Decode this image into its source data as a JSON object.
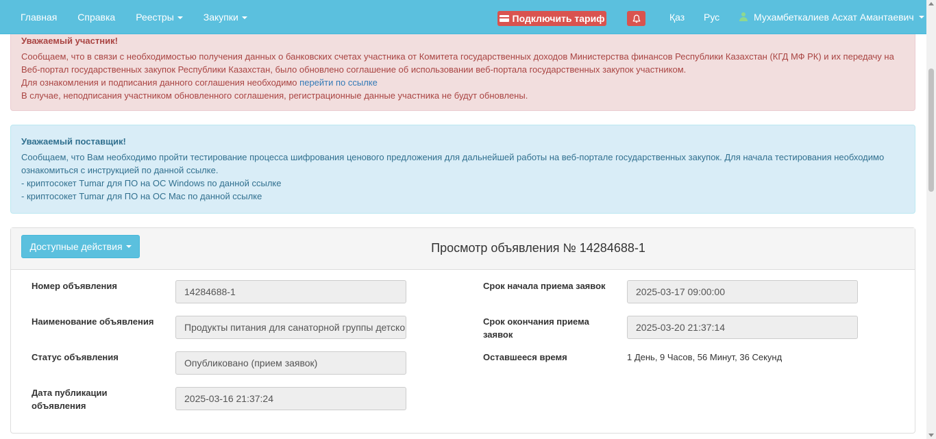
{
  "nav": {
    "links": [
      "Главная",
      "Справка",
      "Реестры",
      "Закупки"
    ],
    "tariff_label": "Подключить тариф",
    "lang_kz": "Қаз",
    "lang_ru": "Рус",
    "user_name": "Мухамбеткалиев Асхат Амантаевич"
  },
  "alert_participant": {
    "title": "Уважаемый участник!",
    "line1": "Сообщаем, что в связи с необходимостью получения данных о банковских счетах участника от Комитета государственных доходов Министерства финансов Республики Казахстан (КГД МФ РК) и их передачу на",
    "line2": "Веб-портал государственных закупок Республики Казахстан, было обновлено соглашение об использовании веб-портала государственных закупок участником.",
    "line3": "Для ознакомления и подписания данного соглашения необходимо",
    "link": "перейти по ссылке",
    "line4": "В случае, неподписания участником обновленного соглашения, регистрационные данные участника не будут обновлены."
  },
  "alert_supplier": {
    "title": "Уважаемый поставщик!",
    "line1": "Сообщаем, что Вам необходимо пройти тестирование процесса шифрования ценового предложения для дальнейшей работы на веб-портале государственных закупок. Для начала тестирования необходимо",
    "line2": "ознакомиться с инструкцией по данной ссылке.",
    "line3": "- криптосокет Tumar для ПО на ОС Windows по данной ссылке",
    "line4": "- криптосокет Tumar для ПО на ОС Mac по данной ссылке"
  },
  "panel": {
    "actions_label": "Доступные действия",
    "title": "Просмотр объявления № 14284688-1"
  },
  "fields": {
    "number_label": "Номер объявления",
    "number_value": "14284688-1",
    "name_label": "Наименование объявления",
    "name_value": "Продукты питания для санаторной группы детского сада",
    "status_label": "Статус объявления",
    "status_value": "Опубликовано (прием заявок)",
    "pub_label_1": "Дата публикации",
    "pub_label_2": "объявления",
    "pub_value": "2025-03-16 21:37:24",
    "start_label": "Срок начала приема заявок",
    "start_value": "2025-03-17 09:00:00",
    "end_label_1": "Срок окончания приема",
    "end_label_2": "заявок",
    "end_value": "2025-03-20 21:37:14",
    "remaining_label": "Оставшееся время",
    "remaining_value": "1 День, 9 Часов, 56 Минут, 36 Секунд"
  }
}
